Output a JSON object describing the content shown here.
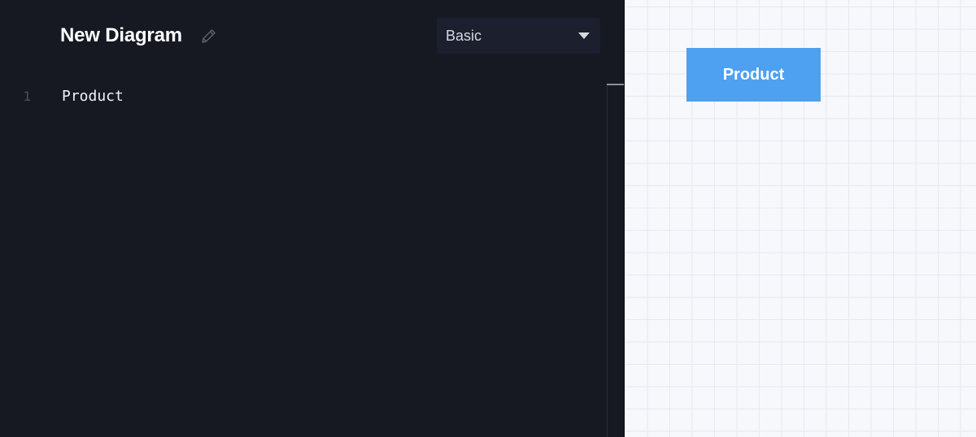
{
  "header": {
    "title": "New Diagram",
    "edit_icon": "pencil-icon"
  },
  "template_select": {
    "selected": "Basic",
    "icon": "caret-down-icon"
  },
  "editor": {
    "lines": [
      {
        "number": "1",
        "text": "Product"
      }
    ]
  },
  "canvas": {
    "nodes": [
      {
        "label": "Product",
        "color": "#4da1f0"
      }
    ]
  },
  "colors": {
    "editor_background": "#161922",
    "canvas_background": "#f7f8fc",
    "node_fill": "#4da1f0"
  }
}
